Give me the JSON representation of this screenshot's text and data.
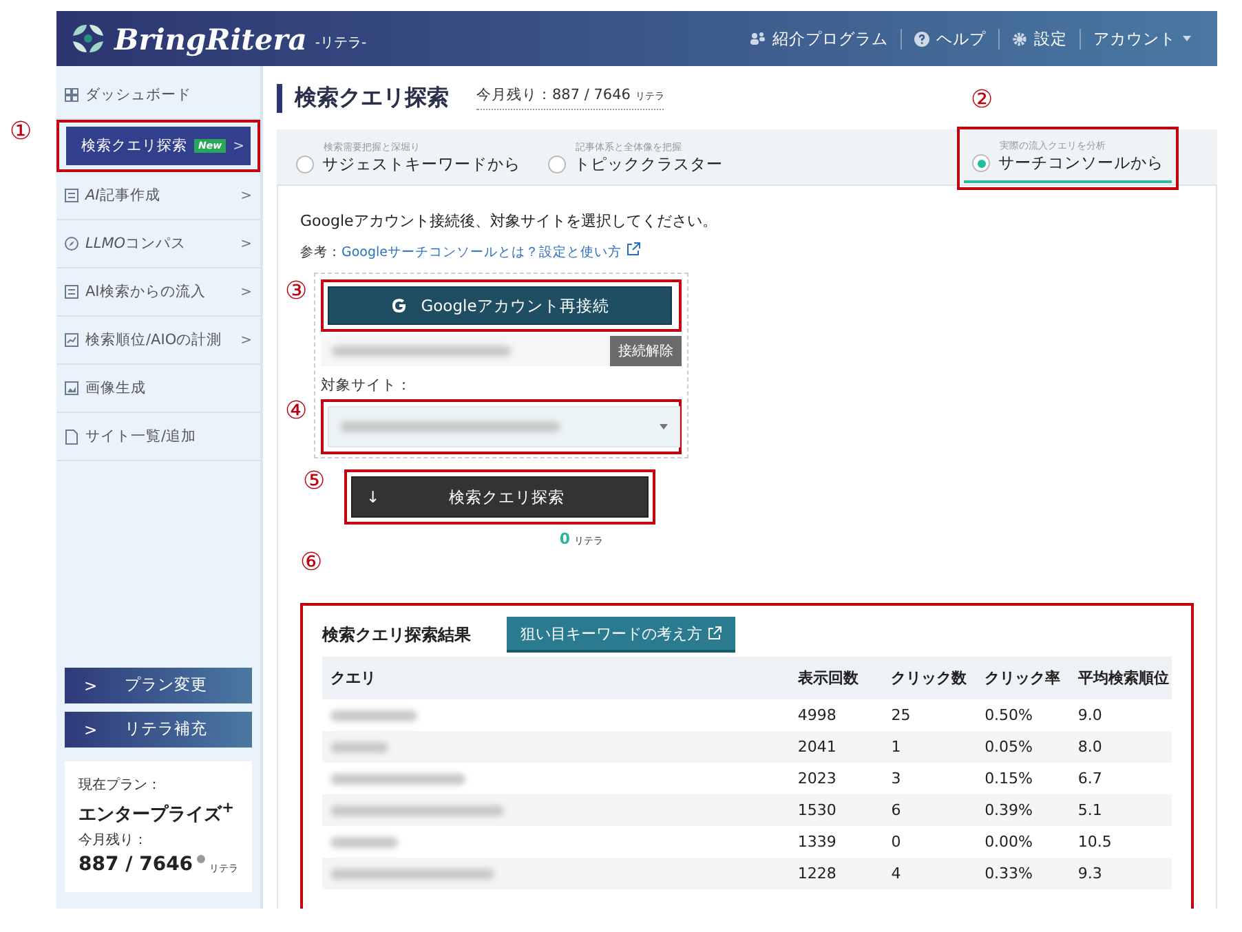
{
  "header": {
    "logo": "BringRitera",
    "logo_sub": "-リテラ-",
    "nav": [
      {
        "label": "紹介プログラム"
      },
      {
        "label": "ヘルプ"
      },
      {
        "label": "設定"
      },
      {
        "label": "アカウント"
      }
    ]
  },
  "sidebar": {
    "items": [
      {
        "label": "ダッシュボード",
        "selected": false,
        "submenu": false
      },
      {
        "label": "検索クエリ探索",
        "selected": true,
        "submenu": true,
        "badge": "New",
        "annotation": "①"
      },
      {
        "lead": "AI",
        "label": "記事作成",
        "selected": false,
        "submenu": true
      },
      {
        "lead": "LLMO",
        "label": "コンパス",
        "selected": false,
        "submenu": true
      },
      {
        "label": "AI検索からの流入",
        "selected": false,
        "submenu": true
      },
      {
        "label": "検索順位/AIOの計測",
        "selected": false,
        "submenu": true
      },
      {
        "label": "画像生成",
        "selected": false,
        "submenu": false
      },
      {
        "label": "サイト一覧/追加",
        "selected": false,
        "submenu": false
      }
    ],
    "buttons": [
      {
        "arrow": ">",
        "label": "プラン変更"
      },
      {
        "arrow": ">",
        "label": "リテラ補充"
      }
    ],
    "plan": {
      "plan_label": "現在プラン：",
      "plan_name": "エンタープライズ$^{+}$",
      "remaining_label": "今月残り：",
      "remaining": "887 / 7646",
      "unit": "リテラ"
    }
  },
  "page": {
    "title": "検索クエリ探索",
    "remaining": "今月残り：887 / 7646",
    "remaining_unit": "リテラ"
  },
  "tabs": [
    {
      "caption": "検索需要把握と深堀り",
      "label": "サジェストキーワードから",
      "selected": false
    },
    {
      "caption": "記事体系と全体像を把握",
      "label": "トピッククラスター",
      "selected": false
    },
    {
      "caption": "実際の流入クエリを分析",
      "label": "サーチコンソールから",
      "selected": true,
      "annotation": "②"
    }
  ],
  "instruction": "Googleアカウント接続後、対象サイトを選択してください。",
  "reference": {
    "prefix": "参考：",
    "link": "Googleサーチコンソールとは？設定と使い方"
  },
  "connect": {
    "google_button": "Googleアカウント再接続",
    "google_annotation": "③",
    "disconnect_button": "接続解除",
    "site_label": "対象サイト：",
    "site_annotation": "④"
  },
  "search_button": {
    "arrow": "↓",
    "label": "検索クエリ探索",
    "annotation": "⑤",
    "cost": "0",
    "cost_unit": "リテラ"
  },
  "results": {
    "annotation": "⑥",
    "title": "検索クエリ探索結果",
    "guide_button": "狙い目キーワードの考え方",
    "columns": [
      "クエリ",
      "表示回数",
      "クリック数",
      "クリック率",
      "平均検索順位"
    ],
    "rows": [
      {
        "cells": [
          "",
          "4998",
          "25",
          "0.50%",
          "9.0"
        ]
      },
      {
        "cells": [
          "",
          "2041",
          "1",
          "0.05%",
          "8.0"
        ]
      },
      {
        "cells": [
          "",
          "2023",
          "3",
          "0.15%",
          "6.7"
        ]
      },
      {
        "cells": [
          "",
          "1530",
          "6",
          "0.39%",
          "5.1"
        ]
      },
      {
        "cells": [
          "",
          "1339",
          "0",
          "0.00%",
          "10.5"
        ]
      },
      {
        "cells": [
          "",
          "1228",
          "4",
          "0.33%",
          "9.3"
        ]
      }
    ]
  }
}
